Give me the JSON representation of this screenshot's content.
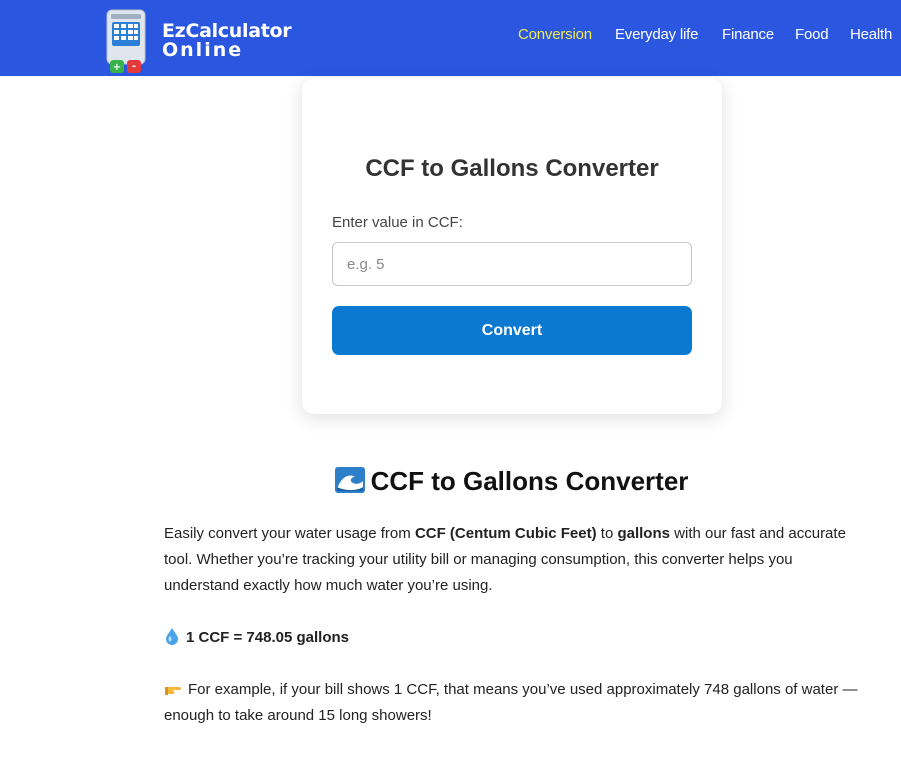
{
  "header": {
    "logo": {
      "line1": "EzCalculator",
      "line2": "Online"
    },
    "nav": [
      {
        "label": "Conversion",
        "active": true
      },
      {
        "label": "Everyday life",
        "active": false
      },
      {
        "label": "Finance",
        "active": false
      },
      {
        "label": "Food",
        "active": false
      },
      {
        "label": "Health",
        "active": false
      }
    ]
  },
  "converter": {
    "title": "CCF to Gallons Converter",
    "input_label": "Enter value in CCF:",
    "input_placeholder": "e.g. 5",
    "input_value": "",
    "button_label": "Convert"
  },
  "article": {
    "title": "CCF to Gallons Converter",
    "title_icon": "wave-icon",
    "intro": {
      "t1": "Easily convert your water usage from ",
      "b1": "CCF (Centum Cubic Feet)",
      "t2": " to ",
      "b2": "gallons",
      "t3": " with our fast and accurate tool. Whether you’re tracking your utility bill or managing consumption, this converter helps you understand exactly how much water you’re using."
    },
    "fact": "1 CCF = 748.05 gallons",
    "fact_icon": "droplet-icon",
    "example": "For example, if your bill shows 1 CCF, that means you’ve used approximately 748 gallons of water — enough to take around 15 long showers!",
    "example_icon": "pointing-hand-icon"
  },
  "colors": {
    "header_bg": "#2a56e0",
    "nav_active": "#f2ea4a",
    "button_bg": "#0b79cf"
  }
}
